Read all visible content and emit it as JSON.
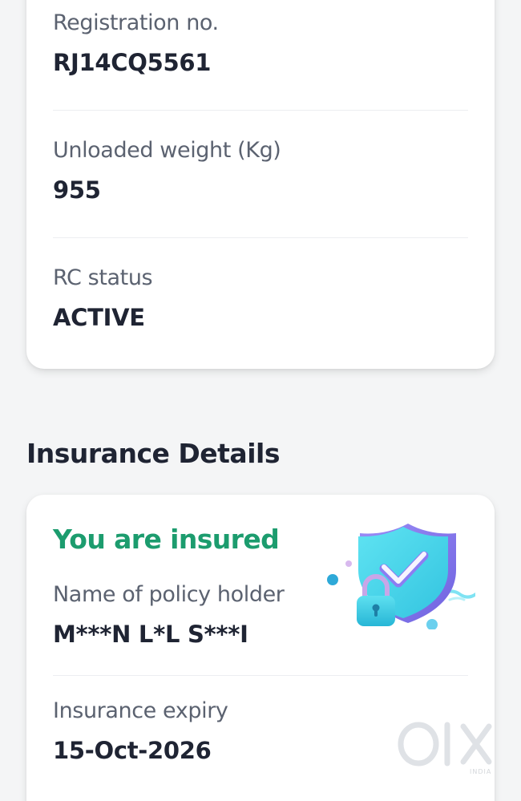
{
  "vehicle": {
    "registration_label": "Registration no.",
    "registration_value": "RJ14CQ5561",
    "weight_label": "Unloaded weight (Kg)",
    "weight_value": "955",
    "rc_label": "RC status",
    "rc_value": "ACTIVE"
  },
  "insurance": {
    "section_title": "Insurance Details",
    "status_text": "You are insured",
    "holder_label": "Name of policy holder",
    "holder_value": "M***N L*L S***I",
    "expiry_label": "Insurance expiry",
    "expiry_value": "15-Oct-2026"
  },
  "watermark": {
    "brand": "OLX",
    "country": "INDIA"
  },
  "colors": {
    "insured_green": "#1c9c6e",
    "shield_cyan": "#4fd8ec",
    "shield_purple": "#8b7cf0"
  },
  "icons": {
    "insurance_illustration": "shield-lock-check-icon"
  }
}
